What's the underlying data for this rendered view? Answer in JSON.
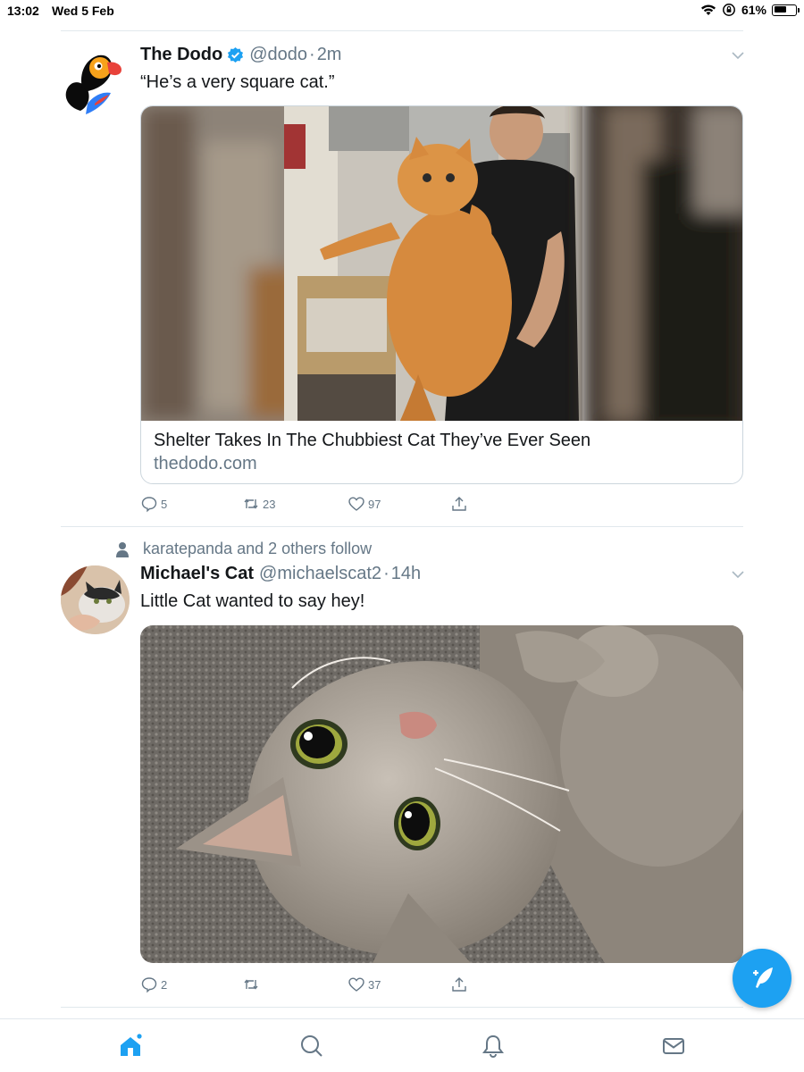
{
  "status_bar": {
    "time": "13:02",
    "date": "Wed 5 Feb",
    "battery": "61%",
    "battery_level": 0.61
  },
  "tweets": [
    {
      "name": "The Dodo",
      "verified": true,
      "handle": "@dodo",
      "time": "2m",
      "text": "“He’s a very square cat.”",
      "card": {
        "title": "Shelter Takes In The Chubbiest Cat They’ve Ever Seen",
        "domain": "thedodo.com"
      },
      "replies": "5",
      "retweets": "23",
      "likes": "97"
    },
    {
      "social_context": "karatepanda and 2 others follow",
      "name": "Michael's Cat",
      "handle": "@michaelscat2",
      "time": "14h",
      "text": "Little Cat wanted to say hey!",
      "replies": "2",
      "retweets": "",
      "likes": "37"
    }
  ],
  "separator": "·",
  "colors": {
    "accent": "#1da1f2",
    "secondary_text": "#657786",
    "divider": "#e1e8ed"
  },
  "tabbar": {
    "icons": [
      "home-icon",
      "search-icon",
      "notifications-icon",
      "messages-icon"
    ],
    "active": "home-icon"
  }
}
